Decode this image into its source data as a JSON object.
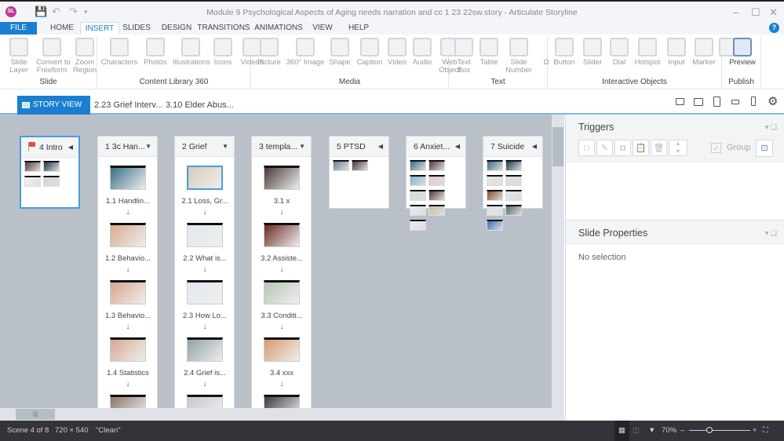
{
  "window": {
    "title": "Module 9 Psychological Aspects of Aging needs narration and cc 1 23 22sw.story -  Articulate Storyline",
    "logo": "SL"
  },
  "menu_tabs": [
    "FILE",
    "HOME",
    "INSERT",
    "SLIDES",
    "DESIGN",
    "TRANSITIONS",
    "ANIMATIONS",
    "VIEW",
    "HELP"
  ],
  "active_tab": "INSERT",
  "ribbon": [
    {
      "group": "Slide",
      "buttons": [
        "Slide\nLayer",
        "Convert to\nFreeform",
        "Zoom\nRegion"
      ]
    },
    {
      "group": "Content Library 360",
      "buttons": [
        "Characters",
        "Photos",
        "Illustrations",
        "Icons",
        "Videos"
      ]
    },
    {
      "group": "Media",
      "buttons": [
        "Picture",
        "360° Image",
        "Shape",
        "Caption",
        "Video",
        "Audio",
        "Web\nObject"
      ]
    },
    {
      "group": "Text",
      "buttons": [
        "Text\nBox",
        "Table",
        "Slide\nNumber",
        "Ω"
      ]
    },
    {
      "group": "Interactive Objects",
      "buttons": [
        "Button",
        "Slider",
        "Dial",
        "Hotspot",
        "Input",
        "Marker",
        ""
      ]
    },
    {
      "group": "Publish",
      "buttons": [
        "Preview"
      ]
    }
  ],
  "story_tabs": {
    "story_view": "STORY VIEW",
    "open": [
      "2.23 Grief Interv...",
      "3.10 Elder Abus..."
    ]
  },
  "scenes": [
    {
      "title": "4 Intro",
      "start": true,
      "selected": true,
      "thumbs": [
        "#5a3a3a",
        "#1d3a50",
        "#f4f4f4",
        "#cfdcc8"
      ]
    },
    {
      "title": "1 3c Han...",
      "slides": [
        "1.1 Handlin...",
        "1.2 Behavio...",
        "1.3 Behavio...",
        "1.4 Statistics",
        ""
      ],
      "thumbs": [
        "#3a6f86",
        "#d9a98f",
        "#d8a48c",
        "#d6a891",
        "#8d7768"
      ]
    },
    {
      "title": "2 Grief",
      "slides": [
        "2.1 Loss, Gr...",
        "2.2 What is...",
        "2.3 How Lo...",
        "2.4 Grief is...",
        ""
      ],
      "thumbs": [
        "#d8cbb4",
        "#dfe8ec",
        "#e1e9ee",
        "#8fa2a8",
        "#c8c8c8"
      ]
    },
    {
      "title": "3  templa...",
      "slides": [
        "3.1 x",
        "3.2 Assiste...",
        "3.3 Conditi...",
        "3.4 xxx",
        ""
      ],
      "thumbs": [
        "#4b3a35",
        "#6b2a25",
        "#b7c6b2",
        "#d69a6c",
        "#3a3a3a"
      ]
    },
    {
      "title": "5 PTSD",
      "thumbs": [
        "#6f7f96",
        "#4a3a38"
      ]
    },
    {
      "title": "6  Anxiet...",
      "thumbs": [
        "#3a6f86",
        "#5a3a3a",
        "#7fb8d0",
        "#e5c9d9",
        "#d8d8d8",
        "#5a3a3a",
        "#e5eef5",
        "#c9bfa8",
        "#eeeeee"
      ]
    },
    {
      "title": "7 Suicide",
      "thumbs": [
        "#3a6f86",
        "#1d3a50",
        "#e4e8ec",
        "#d9dfe3",
        "#8a4a2a",
        "#e0e6ea",
        "#dfe6ea",
        "#556a6a",
        "#3d6fb8"
      ]
    }
  ],
  "triggers": {
    "title": "Triggers",
    "group_label": "Group"
  },
  "slide_properties": {
    "title": "Slide Properties",
    "empty": "No selection"
  },
  "status": {
    "scene": "Scene 4 of 8",
    "size": "720 × 540",
    "theme": "\"Clean\"",
    "zoom": "70%"
  }
}
